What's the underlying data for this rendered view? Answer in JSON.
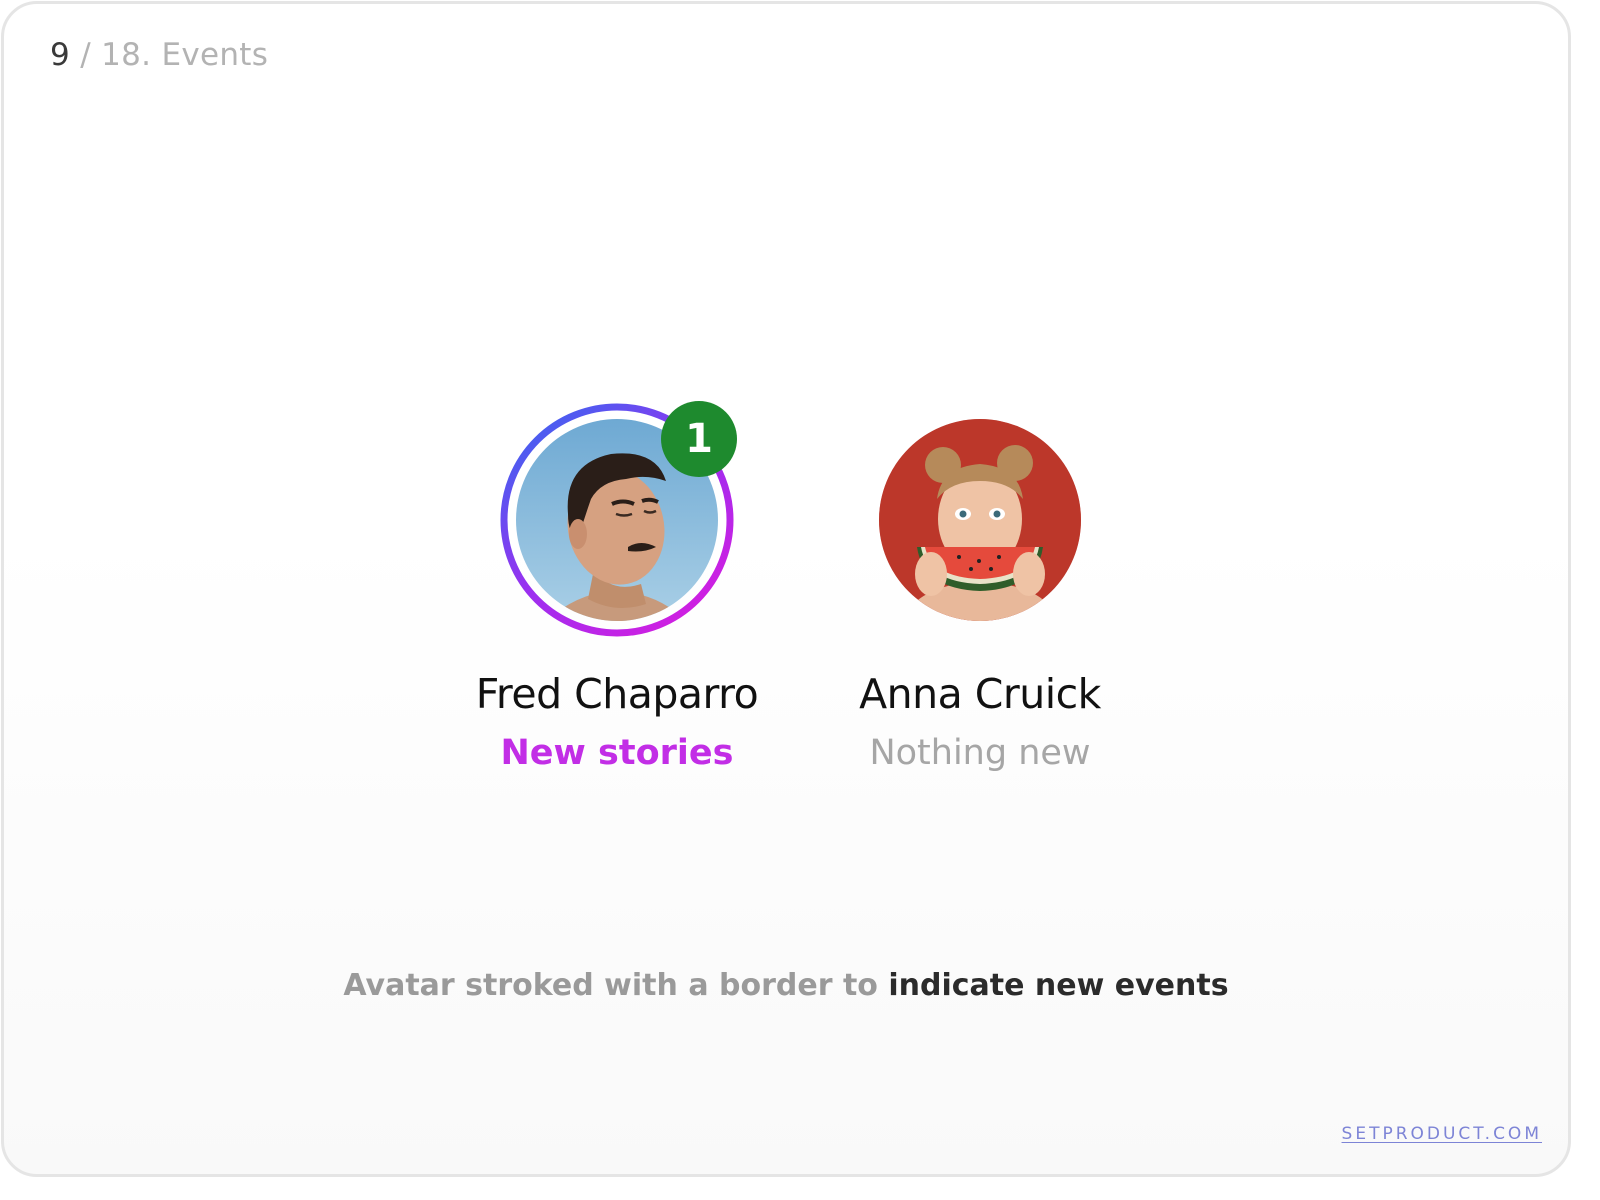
{
  "page_counter": {
    "current": "9",
    "rest": "/ 18. Events"
  },
  "avatars": [
    {
      "name": "Fred Chaparro",
      "status": "New stories",
      "badge_count": "1",
      "has_new_events": true
    },
    {
      "name": "Anna Cruick",
      "status": "Nothing new",
      "has_new_events": false
    }
  ],
  "caption": {
    "muted": "Avatar stroked with a border to",
    "emphasis": "indicate new events"
  },
  "brand": "SETPRODUCT.COM",
  "colors": {
    "ring_start": "#2f6df0",
    "ring_end": "#d41ee0",
    "badge": "#1e8a2e",
    "status_new": "#c22ee6",
    "status_muted": "#a6a6a6",
    "brand": "#7d84d6"
  }
}
